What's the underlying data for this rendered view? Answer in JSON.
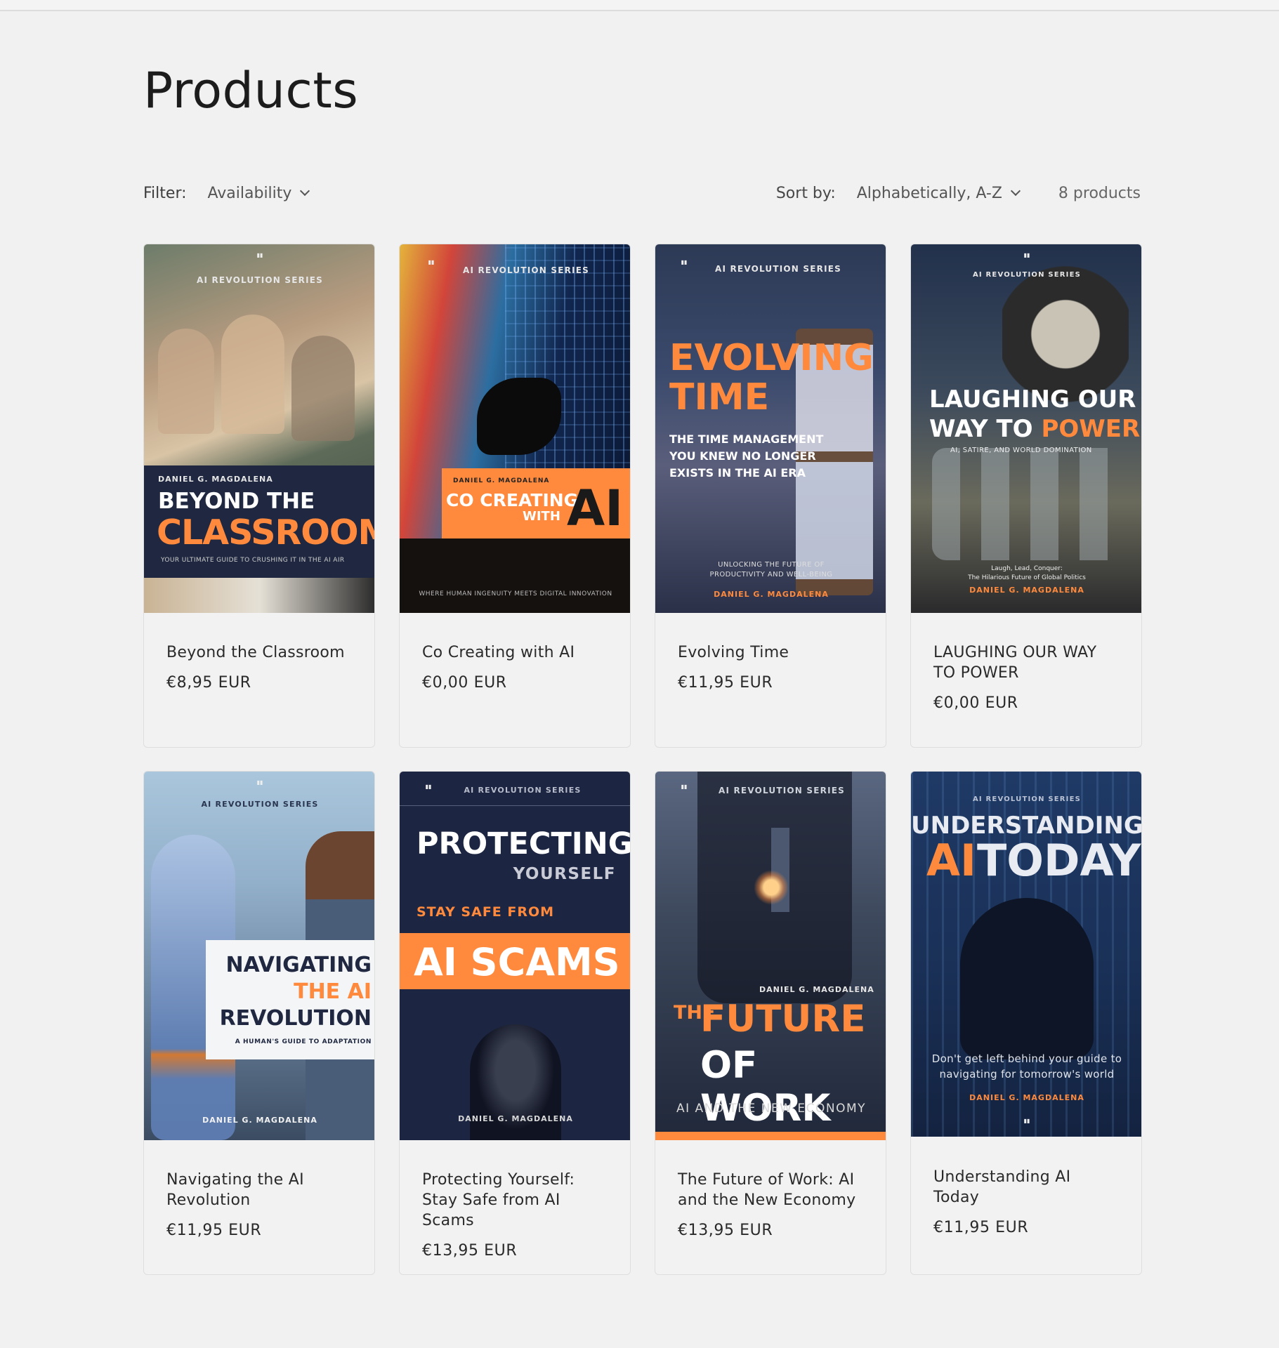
{
  "page": {
    "title": "Products"
  },
  "toolbar": {
    "filter_label": "Filter:",
    "availability_label": "Availability",
    "sort_label": "Sort by:",
    "sort_value": "Alphabetically, A-Z",
    "product_count": "8 products"
  },
  "colors": {
    "accent": "#ff8a3d",
    "navy": "#1f2840",
    "background": "#f1f1f1"
  },
  "products": [
    {
      "title": "Beyond the Classroom",
      "price": "€8,95 EUR",
      "cover": {
        "series": "AI REVOLUTION SERIES",
        "author": "DANIEL G. MAGDALENA",
        "line1": "BEYOND THE",
        "line2": "CLASSROOM",
        "tagline": "YOUR ULTIMATE GUIDE TO CRUSHING IT IN THE AI AIR"
      }
    },
    {
      "title": "Co Creating with AI",
      "price": "€0,00 EUR",
      "cover": {
        "series": "AI REVOLUTION SERIES",
        "author": "DANIEL G. MAGDALENA",
        "line1": "CO CREATING",
        "line2": "WITH",
        "line3": "AI",
        "tagline": "WHERE HUMAN INGENUITY MEETS DIGITAL INNOVATION"
      }
    },
    {
      "title": "Evolving Time",
      "price": "€11,95 EUR",
      "cover": {
        "series": "AI REVOLUTION SERIES",
        "line1": "EVOLVING",
        "line2": "TIME",
        "subtitle": "THE TIME MANAGEMENT YOU KNEW NO LONGER EXISTS IN THE AI ERA",
        "tagline1": "UNLOCKING THE FUTURE OF",
        "tagline2": "PRODUCTIVITY AND WELL-BEING",
        "author": "DANIEL G. MAGDALENA"
      }
    },
    {
      "title": "LAUGHING OUR WAY TO POWER",
      "price": "€0,00 EUR",
      "cover": {
        "series": "AI REVOLUTION SERIES",
        "line1": "LAUGHING OUR",
        "line2a": "WAY TO",
        "line2b": "POWER",
        "subtitle": "AI, SATIRE, AND WORLD DOMINATION",
        "tagline1": "Laugh, Lead, Conquer:",
        "tagline2": "The Hilarious Future of Global Politics",
        "author": "DANIEL G. MAGDALENA"
      }
    },
    {
      "title": "Navigating the AI Revolution",
      "price": "€11,95 EUR",
      "cover": {
        "series": "AI REVOLUTION SERIES",
        "line1": "NAVIGATING",
        "line2": "THE AI",
        "line3": "REVOLUTION",
        "subtitle": "A HUMAN'S GUIDE TO ADAPTATION",
        "author": "DANIEL G. MAGDALENA"
      }
    },
    {
      "title": "Protecting Yourself: Stay Safe from AI Scams",
      "price": "€13,95 EUR",
      "cover": {
        "series": "AI REVOLUTION SERIES",
        "line1": "PROTECTING",
        "line2": "YOURSELF",
        "line3": "STAY SAFE FROM",
        "line4": "AI SCAMS",
        "author": "DANIEL G. MAGDALENA"
      }
    },
    {
      "title": "The Future of Work: AI and the New Economy",
      "price": "€13,95 EUR",
      "cover": {
        "series": "AI REVOLUTION SERIES",
        "author": "DANIEL G. MAGDALENA",
        "vertical": "THE",
        "line1": "FUTURE",
        "line2": "OF WORK",
        "subtitle": "AI AND THE NEW ECONOMY"
      }
    },
    {
      "title": "Understanding AI Today",
      "price": "€11,95 EUR",
      "cover": {
        "series": "AI REVOLUTION SERIES",
        "line1": "UNDERSTANDING",
        "line2a": "AI",
        "line2b": "TODAY",
        "tagline": "Don't get left behind your guide to navigating for tomorrow's world",
        "author": "DANIEL G. MAGDALENA"
      }
    }
  ]
}
